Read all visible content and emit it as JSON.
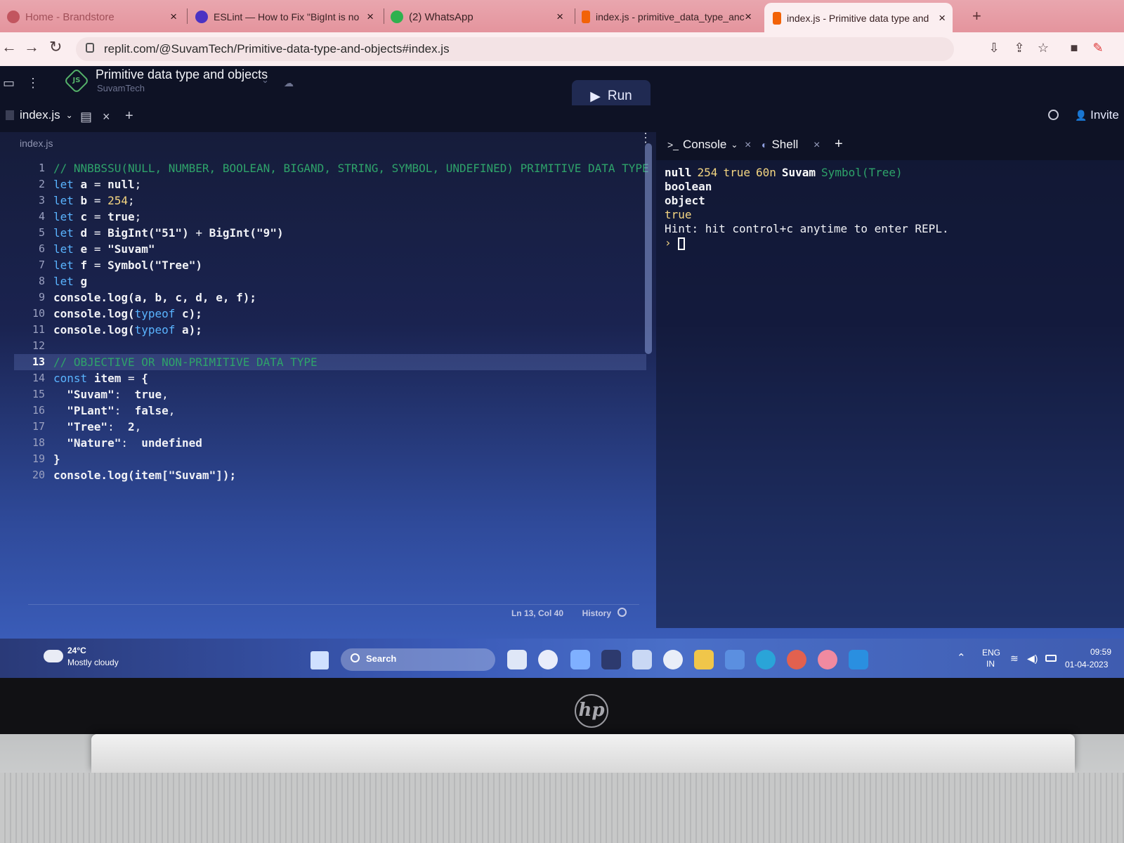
{
  "browser": {
    "tabs": [
      {
        "title": "Home - Brandstore",
        "active": false
      },
      {
        "title": "ESLint — How to Fix \"BigInt is no",
        "active": false
      },
      {
        "title": "(2) WhatsApp",
        "active": false
      },
      {
        "title": "index.js - primitive_data_type_anc",
        "active": false
      },
      {
        "title": "index.js - Primitive data type and",
        "active": true
      }
    ],
    "close_glyph": "×",
    "new_tab_glyph": "+",
    "url": "replit.com/@SuvamTech/Primitive-data-type-and-objects#index.js"
  },
  "replit": {
    "title": "Primitive data type and objects",
    "owner": "SuvamTech",
    "run_label": "Run",
    "invite_label": "Invite",
    "file_tab": "index.js",
    "breadcrumb": "index.js",
    "cursor_position": "Ln 13, Col 40",
    "history_label": "History",
    "console_tab": "Console",
    "shell_tab": "Shell"
  },
  "code": [
    {
      "n": "1",
      "html": "<span class=\"cm\">// NNBBSSU(NULL, NUMBER, BOOLEAN, BIGAND, STRING, SYMBOL, UNDEFINED) PRIMITIVE DATA TYPE</span>"
    },
    {
      "n": "2",
      "html": "<span class=\"kw\">let</span> <span class=\"b\">a</span> = <span class=\"b\">null</span>;"
    },
    {
      "n": "3",
      "html": "<span class=\"kw\">let</span> <span class=\"b\">b</span> = <span class=\"num\">254</span>;"
    },
    {
      "n": "4",
      "html": "<span class=\"kw\">let</span> <span class=\"b\">c</span> = <span class=\"b\">true</span>;"
    },
    {
      "n": "5",
      "html": "<span class=\"kw\">let</span> <span class=\"b\">d</span> = <span class=\"b\">BigInt(</span><span class=\"str\">\"51\"</span><span class=\"b\">)</span> + <span class=\"b\">BigInt(</span><span class=\"str\">\"9\"</span><span class=\"b\">)</span>"
    },
    {
      "n": "6",
      "html": "<span class=\"kw\">let</span> <span class=\"b\">e</span> = <span class=\"str\">\"Suvam\"</span>"
    },
    {
      "n": "7",
      "html": "<span class=\"kw\">let</span> <span class=\"b\">f</span> = <span class=\"b\">Symbol(</span><span class=\"str\">\"Tree\"</span><span class=\"b\">)</span>"
    },
    {
      "n": "8",
      "html": "<span class=\"kw\">let</span> <span class=\"b\">g</span>"
    },
    {
      "n": "9",
      "html": "<span class=\"b\">console.log(a, b, c, d, e, f);</span>"
    },
    {
      "n": "10",
      "html": "<span class=\"b\">console.log(</span><span class=\"kw\">typeof</span> <span class=\"b\">c);</span>"
    },
    {
      "n": "11",
      "html": "<span class=\"b\">console.log(</span><span class=\"kw\">typeof</span> <span class=\"b\">a);</span>"
    },
    {
      "n": "12",
      "html": ""
    },
    {
      "n": "13",
      "html": "<span class=\"cm\">// OBJECTIVE OR NON-PRIMITIVE DATA TYPE</span>",
      "active": true
    },
    {
      "n": "14",
      "html": "<span class=\"kw\">const</span> <span class=\"b\">item</span> = <span class=\"b\">{</span>"
    },
    {
      "n": "15",
      "html": "  <span class=\"str\">\"Suvam\"</span>:  <span class=\"b\">true</span>,"
    },
    {
      "n": "16",
      "html": "  <span class=\"str\">\"PLant\"</span>:  <span class=\"b\">false</span>,"
    },
    {
      "n": "17",
      "html": "  <span class=\"str\">\"Tree\"</span>:  <span class=\"b\">2</span>,"
    },
    {
      "n": "18",
      "html": "  <span class=\"str\">\"Nature\"</span>:  <span class=\"b\">undefined</span>"
    },
    {
      "n": "19",
      "html": "<span class=\"b\">}</span>"
    },
    {
      "n": "20",
      "html": "<span class=\"b\">console.log(item[</span><span class=\"str\">\"Suvam\"</span><span class=\"b\">]);</span>"
    }
  ],
  "console_output": {
    "line1": [
      "null",
      "254",
      "true",
      "60n",
      "Suvam",
      "Symbol(Tree)"
    ],
    "line2": "boolean",
    "line3": "object",
    "line4": "true",
    "hint": "Hint: hit control+c anytime to enter REPL.",
    "prompt": "›"
  },
  "taskbar": {
    "weather_temp": "24°C",
    "weather_desc": "Mostly cloudy",
    "search_label": "Search",
    "lang_1": "ENG",
    "lang_2": "IN",
    "time": "09:59",
    "date": "01-04-2023"
  },
  "device_logo": "hp"
}
